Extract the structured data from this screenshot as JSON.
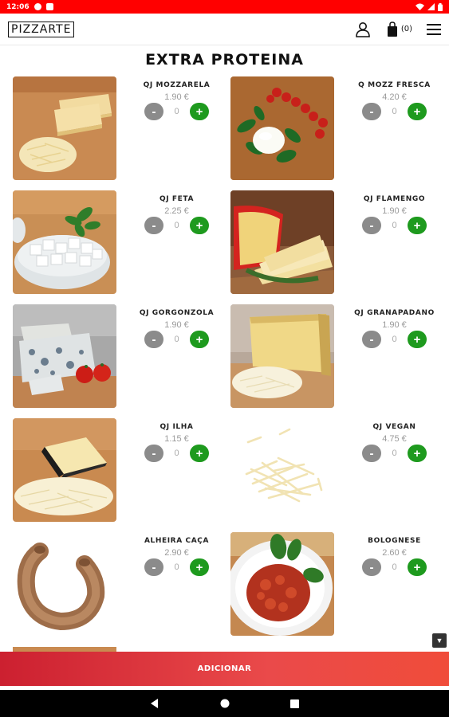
{
  "status_bar": {
    "time": "12:06"
  },
  "header": {
    "logo": "PIZZARTE",
    "cart_count": "(0)"
  },
  "page_title": "EXTRA PROTEINA",
  "products": [
    {
      "name": "QJ MOZZARELA",
      "price": "1.90 €",
      "qty": "0",
      "minus": "-",
      "plus": "+"
    },
    {
      "name": "Q MOZZ FRESCA",
      "price": "4.20 €",
      "qty": "0",
      "minus": "-",
      "plus": "+"
    },
    {
      "name": "QJ FETA",
      "price": "2.25 €",
      "qty": "0",
      "minus": "-",
      "plus": "+"
    },
    {
      "name": "QJ FLAMENGO",
      "price": "1.90 €",
      "qty": "0",
      "minus": "-",
      "plus": "+"
    },
    {
      "name": "QJ GORGONZOLA",
      "price": "1.90 €",
      "qty": "0",
      "minus": "-",
      "plus": "+"
    },
    {
      "name": "QJ GRANAPADANO",
      "price": "1.90 €",
      "qty": "0",
      "minus": "-",
      "plus": "+"
    },
    {
      "name": "QJ ILHA",
      "price": "1.15 €",
      "qty": "0",
      "minus": "-",
      "plus": "+"
    },
    {
      "name": "QJ VEGAN",
      "price": "4.75 €",
      "qty": "0",
      "minus": "-",
      "plus": "+"
    },
    {
      "name": "ALHEIRA CAÇA",
      "price": "2.90 €",
      "qty": "0",
      "minus": "-",
      "plus": "+"
    },
    {
      "name": "BOLOGNESE",
      "price": "2.60 €",
      "qty": "0",
      "minus": "-",
      "plus": "+"
    }
  ],
  "add_button": "ADICIONAR",
  "scroll_button": "▼",
  "colors": {
    "status_bar": "#ff0000",
    "plus_button": "#1e9a1e",
    "minus_button": "#8b8b8b",
    "add_bar": "#e03a3e"
  }
}
